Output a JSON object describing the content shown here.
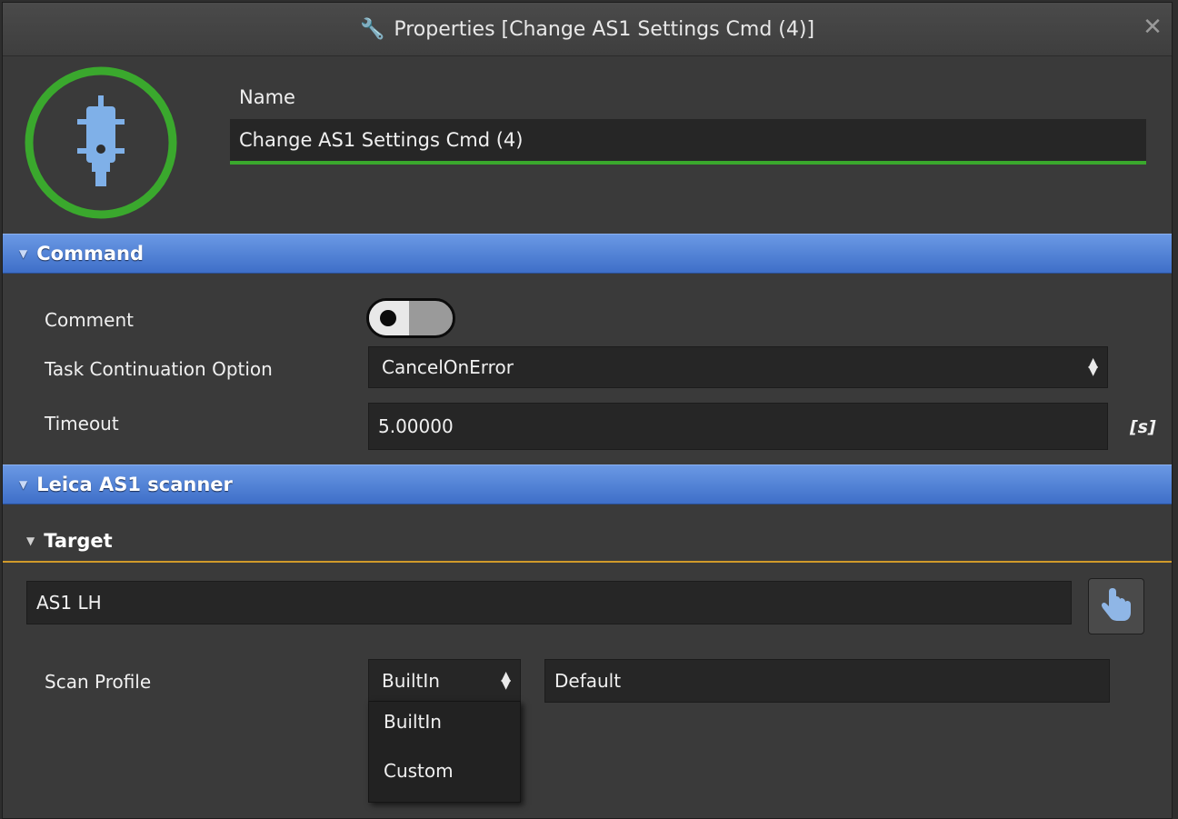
{
  "window": {
    "title": "Properties [Change AS1 Settings Cmd (4)]",
    "title_icon": "wrench-icon",
    "close_glyph": "✕"
  },
  "header": {
    "name_label": "Name",
    "name_value": "Change AS1 Settings Cmd (4)",
    "logo_icon": "scanner-probe-icon",
    "accent_green": "#3aa82d"
  },
  "command_section": {
    "title": "Command",
    "comment_label": "Comment",
    "comment_toggle_on": false,
    "task_continuation_label": "Task Continuation Option",
    "task_continuation_value": "CancelOnError",
    "timeout_label": "Timeout",
    "timeout_value": "5.00000",
    "timeout_unit": "[s]"
  },
  "scanner_section": {
    "title": "Leica AS1 scanner",
    "target_title": "Target",
    "target_value": "AS1 LH",
    "pick_icon": "hand-pointer-icon",
    "scan_profile_label": "Scan Profile",
    "scan_profile_type": "BuiltIn",
    "scan_profile_name": "Default",
    "dropdown_options": [
      "BuiltIn",
      "Custom"
    ]
  },
  "colors": {
    "section_blue": "#4f7fd4",
    "target_underline": "#d09a2a"
  }
}
